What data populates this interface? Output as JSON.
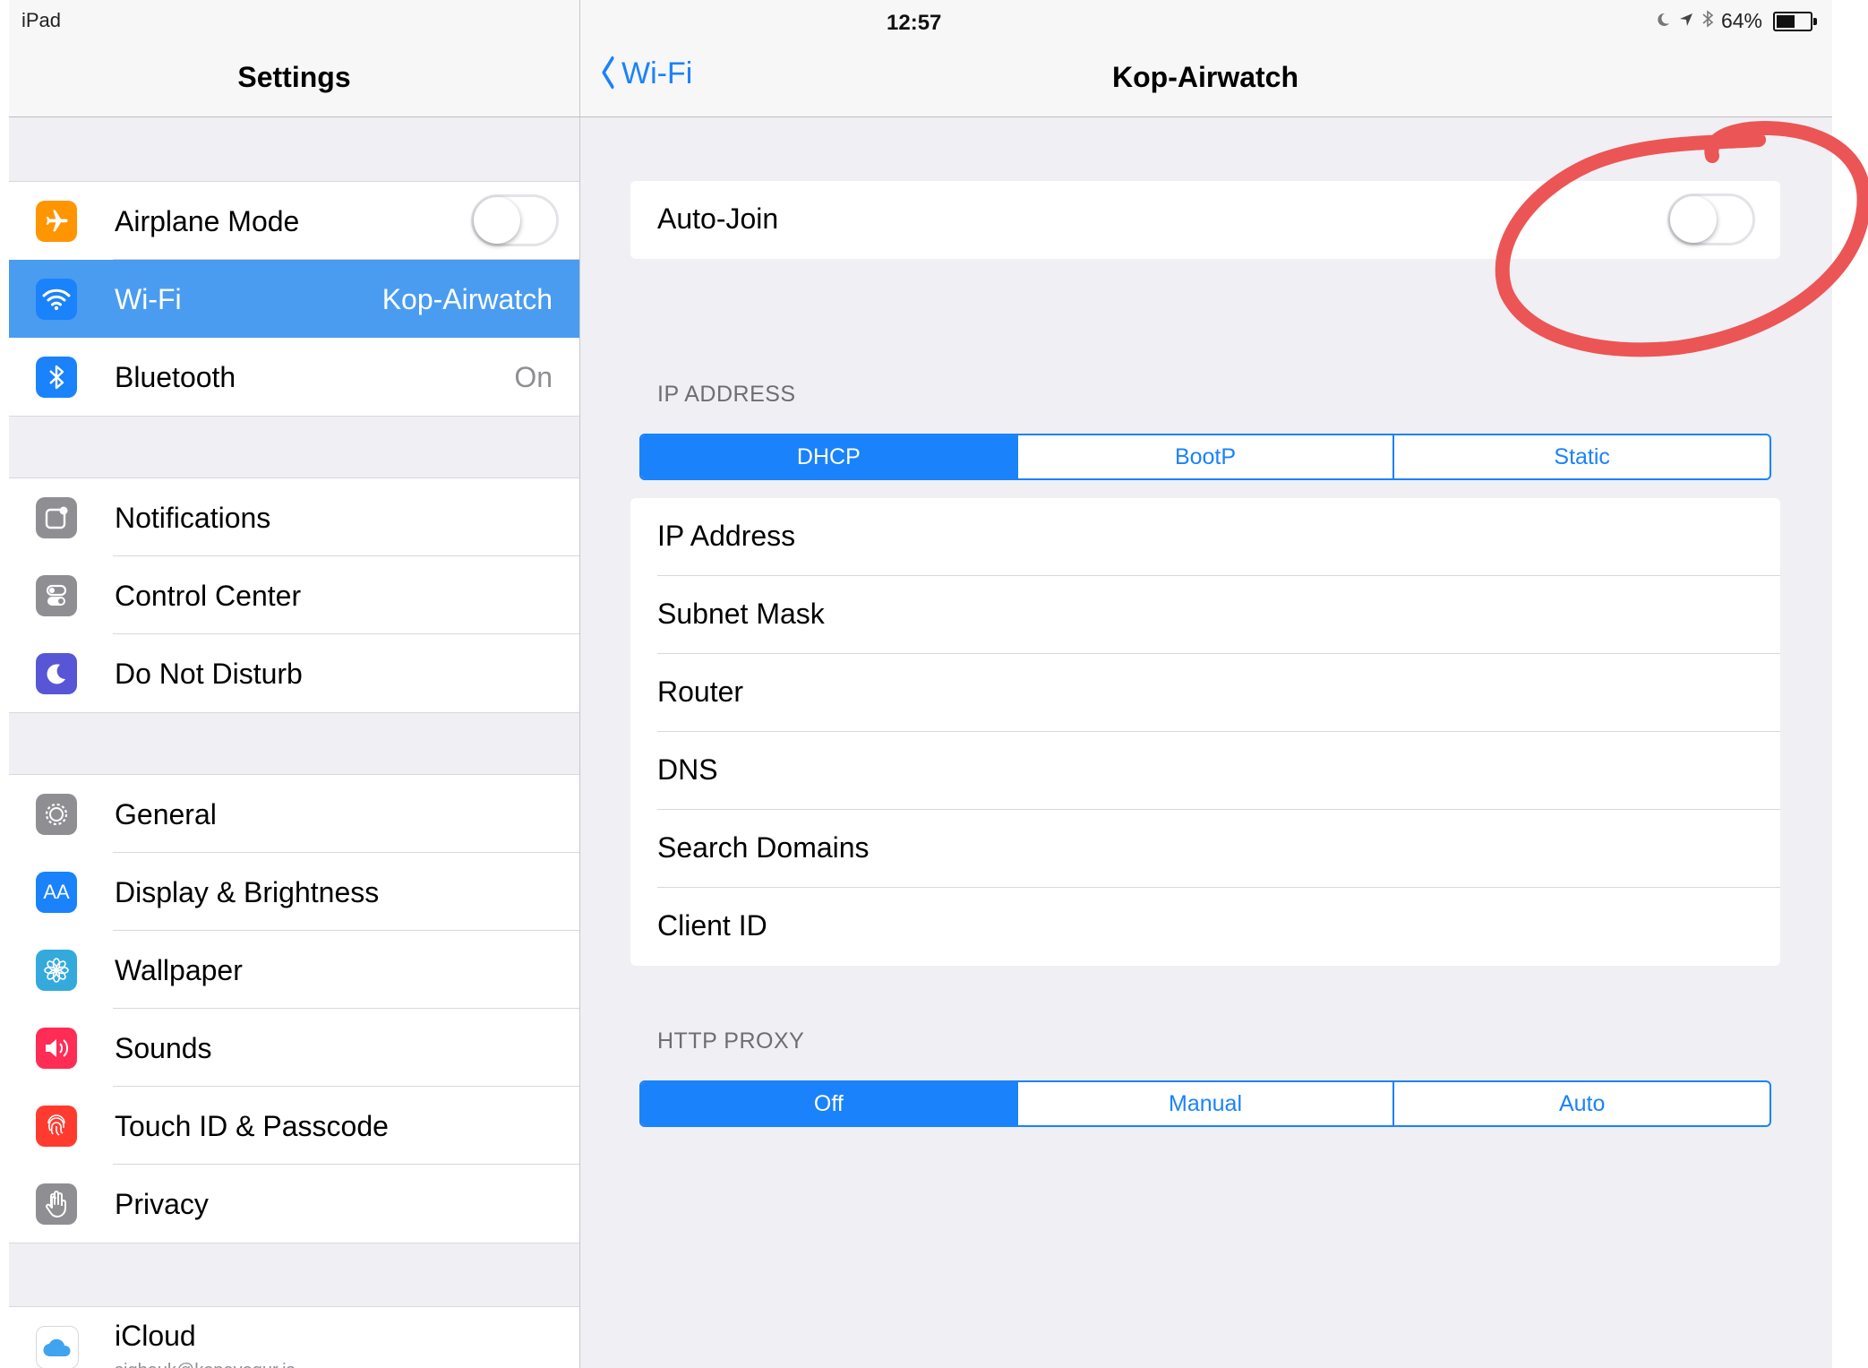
{
  "status_bar": {
    "device": "iPad",
    "time": "12:57",
    "moon_icon": "moon-icon",
    "location_icon": "location-arrow-icon",
    "bluetooth_icon": "bluetooth-icon",
    "battery_percent_text": "64%",
    "battery_level": 0.64
  },
  "master": {
    "title": "Settings",
    "groups": [
      {
        "items": [
          {
            "label": "Airplane Mode",
            "icon": "airplane-icon",
            "icon_color": "#ff9500",
            "toggle": false
          },
          {
            "label": "Wi-Fi",
            "value": "Kop-Airwatch",
            "icon": "wifi-icon",
            "icon_color": "#1a82fb",
            "selected": true
          },
          {
            "label": "Bluetooth",
            "value": "On",
            "icon": "bluetooth-icon",
            "icon_color": "#1a82fb"
          }
        ]
      },
      {
        "items": [
          {
            "label": "Notifications",
            "icon": "notifications-icon",
            "icon_color": "#8e8e93"
          },
          {
            "label": "Control Center",
            "icon": "control-center-icon",
            "icon_color": "#8e8e93"
          },
          {
            "label": "Do Not Disturb",
            "icon": "moon-icon",
            "icon_color": "#5856d6"
          }
        ]
      },
      {
        "items": [
          {
            "label": "General",
            "icon": "gear-icon",
            "icon_color": "#8e8e93"
          },
          {
            "label": "Display & Brightness",
            "icon": "text-size-icon",
            "icon_color": "#1a82fb",
            "icon_text": "AA"
          },
          {
            "label": "Wallpaper",
            "icon": "wallpaper-flower-icon",
            "icon_color": "#34aadc"
          },
          {
            "label": "Sounds",
            "icon": "speaker-icon",
            "icon_color": "#ff2d55"
          },
          {
            "label": "Touch ID & Passcode",
            "icon": "fingerprint-icon",
            "icon_color": "#ff3b30"
          },
          {
            "label": "Privacy",
            "icon": "hand-icon",
            "icon_color": "#8e8e93"
          }
        ]
      },
      {
        "items": [
          {
            "label": "iCloud",
            "sublabel": "sighauk@kopavogur.is",
            "icon": "cloud-icon",
            "icon_color": "#ffffff"
          }
        ]
      }
    ]
  },
  "detail": {
    "back_label": "Wi-Fi",
    "back_icon": "chevron-left-icon",
    "title": "Kop-Airwatch",
    "auto_join": {
      "label": "Auto-Join",
      "toggle": false
    },
    "ip_section": {
      "header": "IP ADDRESS",
      "segments": [
        "DHCP",
        "BootP",
        "Static"
      ],
      "selected": "DHCP",
      "rows": [
        "IP Address",
        "Subnet Mask",
        "Router",
        "DNS",
        "Search Domains",
        "Client ID"
      ]
    },
    "proxy_section": {
      "header": "HTTP PROXY",
      "segments": [
        "Off",
        "Manual",
        "Auto"
      ],
      "selected": "Off"
    }
  },
  "annotation": {
    "shape": "hand-drawn circle around Auto-Join toggle",
    "color": "#ec5555"
  }
}
